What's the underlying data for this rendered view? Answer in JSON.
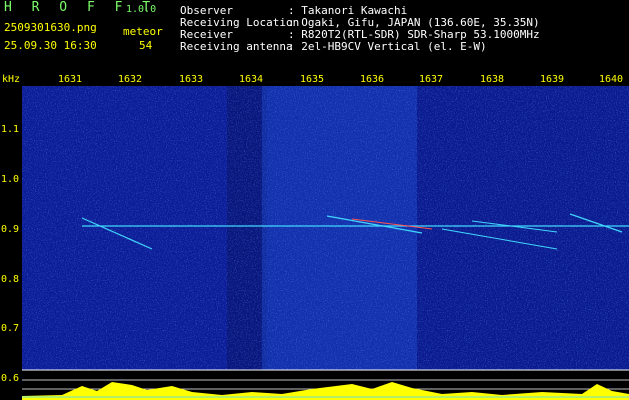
{
  "app": {
    "name": "H R O F F T",
    "version": "1.0.0"
  },
  "file": {
    "name": "2509301630.png",
    "timestamp": "25.09.30 16:30"
  },
  "counter": {
    "label": "meteor",
    "value": "54"
  },
  "info": {
    "observer_label": "Observer",
    "observer_value": ": Takanori Kawachi",
    "location_label": "Receiving Location",
    "location_value": ": Ogaki, Gifu, JAPAN (136.60E, 35.35N)",
    "receiver_label": "Receiver",
    "receiver_value": ": R820T2(RTL-SDR) SDR-Sharp 53.1000MHz",
    "antenna_label": "Receiving antenna",
    "antenna_value": ": 2el-HB9CV Vertical (el. E-W)"
  },
  "axis": {
    "y_unit": "kHz",
    "x_ticks": [
      "1631",
      "1632",
      "1633",
      "1634",
      "1635",
      "1636",
      "1637",
      "1638",
      "1639",
      "1640"
    ],
    "y_ticks": [
      "1.1",
      "1.0",
      "0.9",
      "0.8",
      "0.7",
      "0.6"
    ]
  },
  "colors": {
    "text_green": "#7cff6a",
    "axis_yellow": "#ffff00",
    "background_blue": "#0a1a9a",
    "signal_cyan": "#40d8ff"
  }
}
